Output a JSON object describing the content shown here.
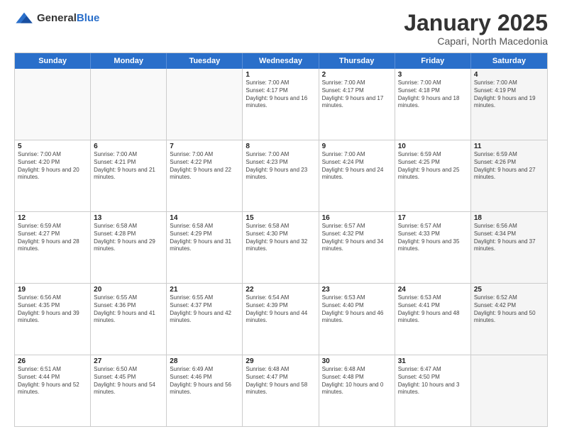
{
  "header": {
    "logo": {
      "text_general": "General",
      "text_blue": "Blue"
    },
    "title": "January 2025",
    "location": "Capari, North Macedonia"
  },
  "weekdays": [
    "Sunday",
    "Monday",
    "Tuesday",
    "Wednesday",
    "Thursday",
    "Friday",
    "Saturday"
  ],
  "weeks": [
    [
      {
        "date": "",
        "info": "",
        "empty": true
      },
      {
        "date": "",
        "info": "",
        "empty": true
      },
      {
        "date": "",
        "info": "",
        "empty": true
      },
      {
        "date": "1",
        "info": "Sunrise: 7:00 AM\nSunset: 4:17 PM\nDaylight: 9 hours and 16 minutes."
      },
      {
        "date": "2",
        "info": "Sunrise: 7:00 AM\nSunset: 4:17 PM\nDaylight: 9 hours and 17 minutes."
      },
      {
        "date": "3",
        "info": "Sunrise: 7:00 AM\nSunset: 4:18 PM\nDaylight: 9 hours and 18 minutes."
      },
      {
        "date": "4",
        "info": "Sunrise: 7:00 AM\nSunset: 4:19 PM\nDaylight: 9 hours and 19 minutes.",
        "shaded": true
      }
    ],
    [
      {
        "date": "5",
        "info": "Sunrise: 7:00 AM\nSunset: 4:20 PM\nDaylight: 9 hours and 20 minutes."
      },
      {
        "date": "6",
        "info": "Sunrise: 7:00 AM\nSunset: 4:21 PM\nDaylight: 9 hours and 21 minutes."
      },
      {
        "date": "7",
        "info": "Sunrise: 7:00 AM\nSunset: 4:22 PM\nDaylight: 9 hours and 22 minutes."
      },
      {
        "date": "8",
        "info": "Sunrise: 7:00 AM\nSunset: 4:23 PM\nDaylight: 9 hours and 23 minutes."
      },
      {
        "date": "9",
        "info": "Sunrise: 7:00 AM\nSunset: 4:24 PM\nDaylight: 9 hours and 24 minutes."
      },
      {
        "date": "10",
        "info": "Sunrise: 6:59 AM\nSunset: 4:25 PM\nDaylight: 9 hours and 25 minutes."
      },
      {
        "date": "11",
        "info": "Sunrise: 6:59 AM\nSunset: 4:26 PM\nDaylight: 9 hours and 27 minutes.",
        "shaded": true
      }
    ],
    [
      {
        "date": "12",
        "info": "Sunrise: 6:59 AM\nSunset: 4:27 PM\nDaylight: 9 hours and 28 minutes."
      },
      {
        "date": "13",
        "info": "Sunrise: 6:58 AM\nSunset: 4:28 PM\nDaylight: 9 hours and 29 minutes."
      },
      {
        "date": "14",
        "info": "Sunrise: 6:58 AM\nSunset: 4:29 PM\nDaylight: 9 hours and 31 minutes."
      },
      {
        "date": "15",
        "info": "Sunrise: 6:58 AM\nSunset: 4:30 PM\nDaylight: 9 hours and 32 minutes."
      },
      {
        "date": "16",
        "info": "Sunrise: 6:57 AM\nSunset: 4:32 PM\nDaylight: 9 hours and 34 minutes."
      },
      {
        "date": "17",
        "info": "Sunrise: 6:57 AM\nSunset: 4:33 PM\nDaylight: 9 hours and 35 minutes."
      },
      {
        "date": "18",
        "info": "Sunrise: 6:56 AM\nSunset: 4:34 PM\nDaylight: 9 hours and 37 minutes.",
        "shaded": true
      }
    ],
    [
      {
        "date": "19",
        "info": "Sunrise: 6:56 AM\nSunset: 4:35 PM\nDaylight: 9 hours and 39 minutes."
      },
      {
        "date": "20",
        "info": "Sunrise: 6:55 AM\nSunset: 4:36 PM\nDaylight: 9 hours and 41 minutes."
      },
      {
        "date": "21",
        "info": "Sunrise: 6:55 AM\nSunset: 4:37 PM\nDaylight: 9 hours and 42 minutes."
      },
      {
        "date": "22",
        "info": "Sunrise: 6:54 AM\nSunset: 4:39 PM\nDaylight: 9 hours and 44 minutes."
      },
      {
        "date": "23",
        "info": "Sunrise: 6:53 AM\nSunset: 4:40 PM\nDaylight: 9 hours and 46 minutes."
      },
      {
        "date": "24",
        "info": "Sunrise: 6:53 AM\nSunset: 4:41 PM\nDaylight: 9 hours and 48 minutes."
      },
      {
        "date": "25",
        "info": "Sunrise: 6:52 AM\nSunset: 4:42 PM\nDaylight: 9 hours and 50 minutes.",
        "shaded": true
      }
    ],
    [
      {
        "date": "26",
        "info": "Sunrise: 6:51 AM\nSunset: 4:44 PM\nDaylight: 9 hours and 52 minutes."
      },
      {
        "date": "27",
        "info": "Sunrise: 6:50 AM\nSunset: 4:45 PM\nDaylight: 9 hours and 54 minutes."
      },
      {
        "date": "28",
        "info": "Sunrise: 6:49 AM\nSunset: 4:46 PM\nDaylight: 9 hours and 56 minutes."
      },
      {
        "date": "29",
        "info": "Sunrise: 6:48 AM\nSunset: 4:47 PM\nDaylight: 9 hours and 58 minutes."
      },
      {
        "date": "30",
        "info": "Sunrise: 6:48 AM\nSunset: 4:48 PM\nDaylight: 10 hours and 0 minutes."
      },
      {
        "date": "31",
        "info": "Sunrise: 6:47 AM\nSunset: 4:50 PM\nDaylight: 10 hours and 3 minutes."
      },
      {
        "date": "",
        "info": "",
        "empty": true,
        "shaded": true
      }
    ]
  ]
}
